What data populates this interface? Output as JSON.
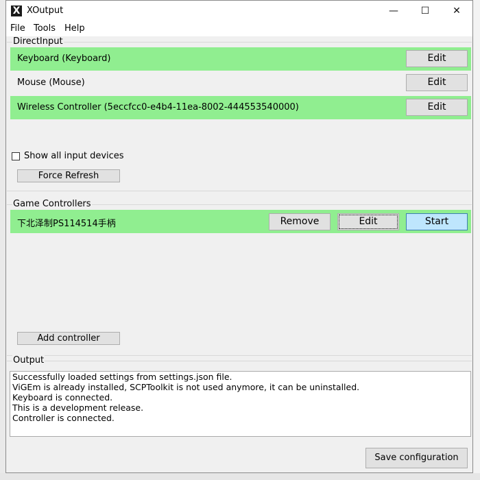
{
  "window": {
    "title": "XOutput",
    "minimize_glyph": "—",
    "maximize_glyph": "☐",
    "close_glyph": "✕"
  },
  "app_icon": {
    "icon": "xoutput-logo-icon",
    "glyph": "X"
  },
  "menu": {
    "items": [
      "File",
      "Tools",
      "Help"
    ]
  },
  "direct_input": {
    "label": "DirectInput",
    "devices": [
      {
        "name": "Keyboard (Keyboard)",
        "active": true,
        "edit_label": "Edit"
      },
      {
        "name": "Mouse (Mouse)",
        "active": false,
        "edit_label": "Edit"
      },
      {
        "name": "Wireless Controller (5eccfcc0-e4b4-11ea-8002-444553540000)",
        "active": true,
        "edit_label": "Edit"
      }
    ],
    "show_all_label": "Show all input devices",
    "show_all_checked": false,
    "force_refresh_label": "Force Refresh"
  },
  "game_controllers": {
    "label": "Game Controllers",
    "controllers": [
      {
        "name": "下北泽制PS114514手柄",
        "remove_label": "Remove",
        "edit_label": "Edit",
        "start_label": "Start"
      }
    ],
    "add_label": "Add controller"
  },
  "output": {
    "label": "Output",
    "lines": [
      "Successfully loaded settings from settings.json file.",
      "ViGEm is already installed, SCPToolkit is not used anymore, it can be uninstalled.",
      "Keyboard is connected.",
      "This is a development release.",
      "Controller is connected."
    ]
  },
  "save_label": "Save configuration",
  "colors": {
    "active_row": "#90ee90",
    "start_button": "#bee6fd",
    "window_bg": "#f0f0f0"
  }
}
